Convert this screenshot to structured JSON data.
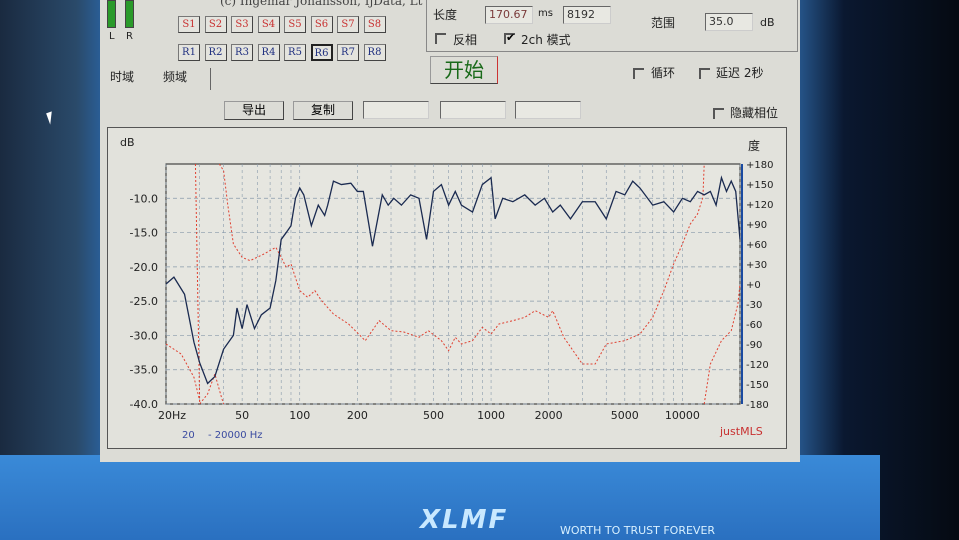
{
  "header": {
    "copyright": "(c) Ingemar Johansson, IjData, Lt",
    "meter_labels": [
      "L",
      "R"
    ]
  },
  "s_buttons": [
    "S1",
    "S2",
    "S3",
    "S4",
    "S5",
    "S6",
    "S7",
    "S8"
  ],
  "r_buttons": [
    "R1",
    "R2",
    "R3",
    "R4",
    "R5",
    "R6",
    "R7",
    "R8"
  ],
  "tabs": [
    {
      "label": "时域"
    },
    {
      "label": "频域"
    }
  ],
  "settings": {
    "length_label": "长度",
    "length_value": "170.67",
    "length_unit": "ms",
    "samples_value": "8192",
    "invert_label": "反相",
    "invert_checked": false,
    "twoch_label": "2ch 模式",
    "twoch_checked": true,
    "range_label": "范围",
    "range_value": "35.0",
    "range_unit": "dB",
    "start_label": "开始",
    "loop_label": "循环",
    "loop_checked": false,
    "delay_label": "延迟 2秒",
    "delay_checked": false
  },
  "toolbar": {
    "export_label": "导出",
    "copy_label": "复制",
    "hide_phase_label": "隐藏相位",
    "hide_phase_checked": false
  },
  "desktop": {
    "logo": "XLMF",
    "slogan": "WORTH TO TRUST FOREVER"
  },
  "chart_data": {
    "type": "line",
    "ylabel": "dB",
    "y2label": "度",
    "brand": "justMLS",
    "range_note_start": "20",
    "range_note_end": "- 20000 Hz",
    "x_scale": "log",
    "xlim": [
      20,
      20000
    ],
    "ylim": [
      -40,
      -5
    ],
    "y2lim": [
      -180,
      180
    ],
    "grid": true,
    "xticks": [
      {
        "v": 20,
        "l": "20Hz"
      },
      {
        "v": 50,
        "l": "50"
      },
      {
        "v": 100,
        "l": "100"
      },
      {
        "v": 200,
        "l": "200"
      },
      {
        "v": 500,
        "l": "500"
      },
      {
        "v": 1000,
        "l": "1000"
      },
      {
        "v": 2000,
        "l": "2000"
      },
      {
        "v": 5000,
        "l": "5000"
      },
      {
        "v": 10000,
        "l": "10000"
      }
    ],
    "yticks": [
      {
        "v": -10,
        "l": "-10.0"
      },
      {
        "v": -15,
        "l": "-15.0"
      },
      {
        "v": -20,
        "l": "-20.0"
      },
      {
        "v": -25,
        "l": "-25.0"
      },
      {
        "v": -30,
        "l": "-30.0"
      },
      {
        "v": -35,
        "l": "-35.0"
      },
      {
        "v": -40,
        "l": "-40.0"
      }
    ],
    "y2ticks": [
      {
        "v": 180,
        "l": "+180"
      },
      {
        "v": 150,
        "l": "+150"
      },
      {
        "v": 120,
        "l": "+120"
      },
      {
        "v": 90,
        "l": "+90"
      },
      {
        "v": 60,
        "l": "+60"
      },
      {
        "v": 30,
        "l": "+30"
      },
      {
        "v": 0,
        "l": "+0"
      },
      {
        "v": -30,
        "l": "-30"
      },
      {
        "v": -60,
        "l": "-60"
      },
      {
        "v": -90,
        "l": "-90"
      },
      {
        "v": -120,
        "l": "-120"
      },
      {
        "v": -150,
        "l": "-150"
      },
      {
        "v": -180,
        "l": "-180"
      }
    ],
    "magnitude": {
      "color": "#1a2a50",
      "points": [
        [
          20,
          -22.5
        ],
        [
          22,
          -21.5
        ],
        [
          25,
          -24
        ],
        [
          28,
          -31
        ],
        [
          30,
          -34
        ],
        [
          33,
          -37
        ],
        [
          36,
          -36
        ],
        [
          40,
          -32
        ],
        [
          45,
          -30
        ],
        [
          47,
          -26
        ],
        [
          50,
          -29
        ],
        [
          53,
          -25.5
        ],
        [
          58,
          -29
        ],
        [
          63,
          -27
        ],
        [
          70,
          -26
        ],
        [
          75,
          -22
        ],
        [
          80,
          -16
        ],
        [
          85,
          -15
        ],
        [
          90,
          -14
        ],
        [
          95,
          -10
        ],
        [
          100,
          -8.5
        ],
        [
          105,
          -9.5
        ],
        [
          115,
          -14
        ],
        [
          125,
          -11
        ],
        [
          135,
          -12.5
        ],
        [
          140,
          -11
        ],
        [
          150,
          -7.5
        ],
        [
          165,
          -8
        ],
        [
          185,
          -7.8
        ],
        [
          200,
          -9
        ],
        [
          215,
          -9
        ],
        [
          240,
          -17
        ],
        [
          270,
          -9.5
        ],
        [
          290,
          -11
        ],
        [
          310,
          -10
        ],
        [
          340,
          -11
        ],
        [
          380,
          -9.5
        ],
        [
          420,
          -10
        ],
        [
          460,
          -16
        ],
        [
          500,
          -9
        ],
        [
          550,
          -8
        ],
        [
          600,
          -11
        ],
        [
          650,
          -9
        ],
        [
          700,
          -11
        ],
        [
          800,
          -12
        ],
        [
          900,
          -8
        ],
        [
          1000,
          -7
        ],
        [
          1050,
          -13
        ],
        [
          1150,
          -10
        ],
        [
          1300,
          -10.5
        ],
        [
          1500,
          -9.5
        ],
        [
          1700,
          -11
        ],
        [
          1900,
          -10
        ],
        [
          2100,
          -12
        ],
        [
          2300,
          -11
        ],
        [
          2600,
          -13
        ],
        [
          3000,
          -10.5
        ],
        [
          3500,
          -10.5
        ],
        [
          4000,
          -13
        ],
        [
          4500,
          -9
        ],
        [
          5000,
          -9.5
        ],
        [
          5500,
          -7.5
        ],
        [
          6000,
          -8.5
        ],
        [
          7000,
          -11
        ],
        [
          8000,
          -10.5
        ],
        [
          9000,
          -12
        ],
        [
          10000,
          -10
        ],
        [
          11000,
          -10.5
        ],
        [
          12000,
          -9
        ],
        [
          13000,
          -9.5
        ],
        [
          14000,
          -9
        ],
        [
          15000,
          -11
        ],
        [
          16000,
          -7
        ],
        [
          17000,
          -9
        ],
        [
          18000,
          -7.5
        ],
        [
          19000,
          -9
        ],
        [
          20000,
          -16
        ]
      ]
    },
    "phase": {
      "color": "#e04030",
      "segments": [
        [
          [
            20,
            -90
          ],
          [
            24,
            -105
          ],
          [
            28,
            -140
          ],
          [
            30,
            -175
          ]
        ],
        [
          [
            28.5,
            180
          ],
          [
            30,
            -180
          ]
        ],
        [
          [
            30,
            -180
          ],
          [
            33,
            -165
          ],
          [
            36,
            -135
          ],
          [
            39,
            -170
          ],
          [
            40,
            -180
          ]
        ],
        [
          [
            38,
            180
          ],
          [
            40,
            170
          ],
          [
            42,
            120
          ],
          [
            45,
            60
          ],
          [
            50,
            40
          ],
          [
            55,
            35
          ],
          [
            65,
            45
          ],
          [
            75,
            55
          ],
          [
            80,
            40
          ],
          [
            85,
            25
          ],
          [
            90,
            30
          ],
          [
            100,
            -10
          ],
          [
            110,
            -20
          ],
          [
            120,
            -10
          ],
          [
            130,
            -25
          ],
          [
            150,
            -45
          ],
          [
            180,
            -60
          ],
          [
            220,
            -85
          ],
          [
            260,
            -55
          ],
          [
            300,
            -70
          ],
          [
            350,
            -72
          ],
          [
            420,
            -80
          ],
          [
            470,
            -70
          ],
          [
            550,
            -85
          ],
          [
            600,
            -100
          ],
          [
            650,
            -80
          ],
          [
            700,
            -90
          ],
          [
            800,
            -85
          ],
          [
            900,
            -65
          ],
          [
            1000,
            -75
          ],
          [
            1100,
            -60
          ],
          [
            1300,
            -55
          ],
          [
            1500,
            -50
          ],
          [
            1700,
            -40
          ],
          [
            2000,
            -50
          ],
          [
            2100,
            -40
          ],
          [
            2400,
            -80
          ],
          [
            3000,
            -120
          ],
          [
            3500,
            -120
          ],
          [
            4000,
            -90
          ],
          [
            5000,
            -85
          ],
          [
            6000,
            -75
          ],
          [
            7000,
            -50
          ],
          [
            8000,
            -10
          ],
          [
            9000,
            30
          ],
          [
            10000,
            60
          ],
          [
            11000,
            90
          ],
          [
            12000,
            105
          ],
          [
            12800,
            130
          ],
          [
            13000,
            180
          ]
        ],
        [
          [
            13000,
            -180
          ],
          [
            14000,
            -120
          ],
          [
            16000,
            -85
          ],
          [
            18000,
            -70
          ],
          [
            19500,
            -30
          ],
          [
            20000,
            0
          ]
        ]
      ]
    }
  }
}
